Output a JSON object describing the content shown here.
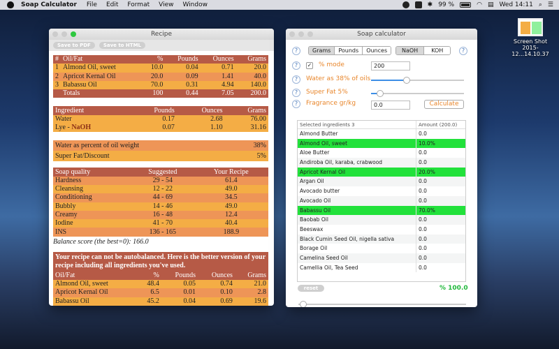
{
  "menubar": {
    "app_name": "Soap Calculator",
    "items": [
      "File",
      "Edit",
      "Format",
      "View",
      "Window"
    ],
    "battery": "99 %",
    "clock": "Wed 14:11"
  },
  "desktop": {
    "icon_label_1": "Screen Shot",
    "icon_label_2": "2015-12...14.10.37"
  },
  "recipe_window": {
    "title": "Recipe",
    "save_pdf": "Save to PDF",
    "save_html": "Save to HTML",
    "oils_table": {
      "headers": [
        "#",
        "Oil/Fat",
        "%",
        "Pounds",
        "Ounces",
        "Grams"
      ],
      "rows": [
        [
          "1",
          "Almond Oil, sweet",
          "10.0",
          "0.04",
          "0.71",
          "20.0"
        ],
        [
          "2",
          "Apricot Kernal Oil",
          "20.0",
          "0.09",
          "1.41",
          "40.0"
        ],
        [
          "3",
          "Babassu Oil",
          "70.0",
          "0.31",
          "4.94",
          "140.0"
        ]
      ],
      "totals": [
        "Totals",
        "100",
        "0.44",
        "7.05",
        "200.0"
      ]
    },
    "ingredients_table": {
      "headers": [
        "Ingredient",
        "Pounds",
        "Ounces",
        "Grams"
      ],
      "water": [
        "Water",
        "0.17",
        "2.68",
        "76.00"
      ],
      "lye": {
        "prefix": "Lye - ",
        "name": "NaOH",
        "values": [
          "0.07",
          "1.10",
          "31.16"
        ]
      }
    },
    "settings_table": {
      "rows": [
        [
          "Water as percent of oil weight",
          "38%"
        ],
        [
          "Super Fat/Discount",
          "5%"
        ]
      ]
    },
    "quality_table": {
      "headers": [
        "Soap quality",
        "Suggested",
        "Your Recipe"
      ],
      "rows": [
        [
          "Hardness",
          "29 - 54",
          "61.4"
        ],
        [
          "Cleansing",
          "12 - 22",
          "49.0"
        ],
        [
          "Conditioning",
          "44 - 69",
          "34.5"
        ],
        [
          "Bubbly",
          "14 - 46",
          "49.0"
        ],
        [
          "Creamy",
          "16 - 48",
          "12.4"
        ],
        [
          "Iodine",
          "41 - 70",
          "40.4"
        ],
        [
          "INS",
          "136 - 165",
          "188.9"
        ]
      ]
    },
    "balance_score": "Balance score (the best=0): 166.0",
    "note": "Your recipe can not be autobalanced. Here is the better version of your recipe including all ingredients you've used.",
    "better_table": {
      "headers": [
        "Oil/Fat",
        "%",
        "Pounds",
        "Ounces",
        "Grams"
      ],
      "rows": [
        [
          "Almond Oil, sweet",
          "48.4",
          "0.05",
          "0.74",
          "21.0"
        ],
        [
          "Apricot Kernal Oil",
          "6.5",
          "0.01",
          "0.10",
          "2.8"
        ],
        [
          "Babassu Oil",
          "45.2",
          "0.04",
          "0.69",
          "19.6"
        ]
      ]
    }
  },
  "calc_window": {
    "title": "Soap calculator",
    "units": [
      "Grams",
      "Pounds",
      "Ounces"
    ],
    "lye_types": [
      "NaOH",
      "KOH"
    ],
    "percent_mode_label": "% mode",
    "percent_mode_checked": true,
    "total_value": "200",
    "water_label": "Water as 38% of oils",
    "water_slider_fraction": 0.38,
    "superfat_label": "Super Fat 5%",
    "superfat_slider_fraction": 0.05,
    "fragrance_label": "Fragrance gr/kg",
    "fragrance_value": "0.0",
    "calculate": "Calculate",
    "list_header": [
      "Selected ingredients 3",
      "Amount (200.0)"
    ],
    "ingredients": [
      [
        "Almond Butter",
        "0.0",
        false
      ],
      [
        "Almond Oil, sweet",
        "10.0%",
        true
      ],
      [
        "Aloe Butter",
        "0.0",
        false
      ],
      [
        "Andiroba Oil, karaba, crabwood",
        "0.0",
        false
      ],
      [
        "Apricot Kernal Oil",
        "20.0%",
        true
      ],
      [
        "Argan Oil",
        "0.0",
        false
      ],
      [
        "Avocado butter",
        "0.0",
        false
      ],
      [
        "Avocado Oil",
        "0.0",
        false
      ],
      [
        "Babassu Oil",
        "70.0%",
        true
      ],
      [
        "Baobab Oil",
        "0.0",
        false
      ],
      [
        "Beeswax",
        "0.0",
        false
      ],
      [
        "Black Cumin Seed Oil, nigella sativa",
        "0.0",
        false
      ],
      [
        "Borage Oil",
        "0.0",
        false
      ],
      [
        "Camelina Seed Oil",
        "0.0",
        false
      ],
      [
        "Camellia Oil, Tea Seed",
        "0.0",
        false
      ]
    ],
    "reset": "reset",
    "percent_total": "% 100.0",
    "help": "?"
  }
}
